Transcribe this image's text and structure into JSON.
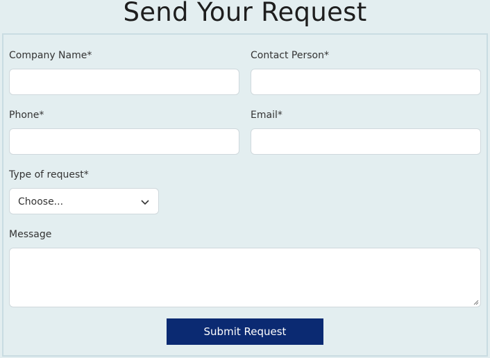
{
  "page": {
    "title": "Send Your Request"
  },
  "form": {
    "company_name_label": "Company Name*",
    "contact_person_label": "Contact Person*",
    "phone_label": "Phone*",
    "email_label": "Email*",
    "request_type_label": "Type of request*",
    "request_type_selected": "Choose...",
    "message_label": "Message",
    "submit_label": "Submit Request"
  },
  "icons": {
    "select_arrow": "chevron-down-icon",
    "resize": "resize-handle-icon"
  },
  "colors": {
    "background": "#e3eef0",
    "button": "#0b2a72",
    "button_text": "#ffffff"
  }
}
